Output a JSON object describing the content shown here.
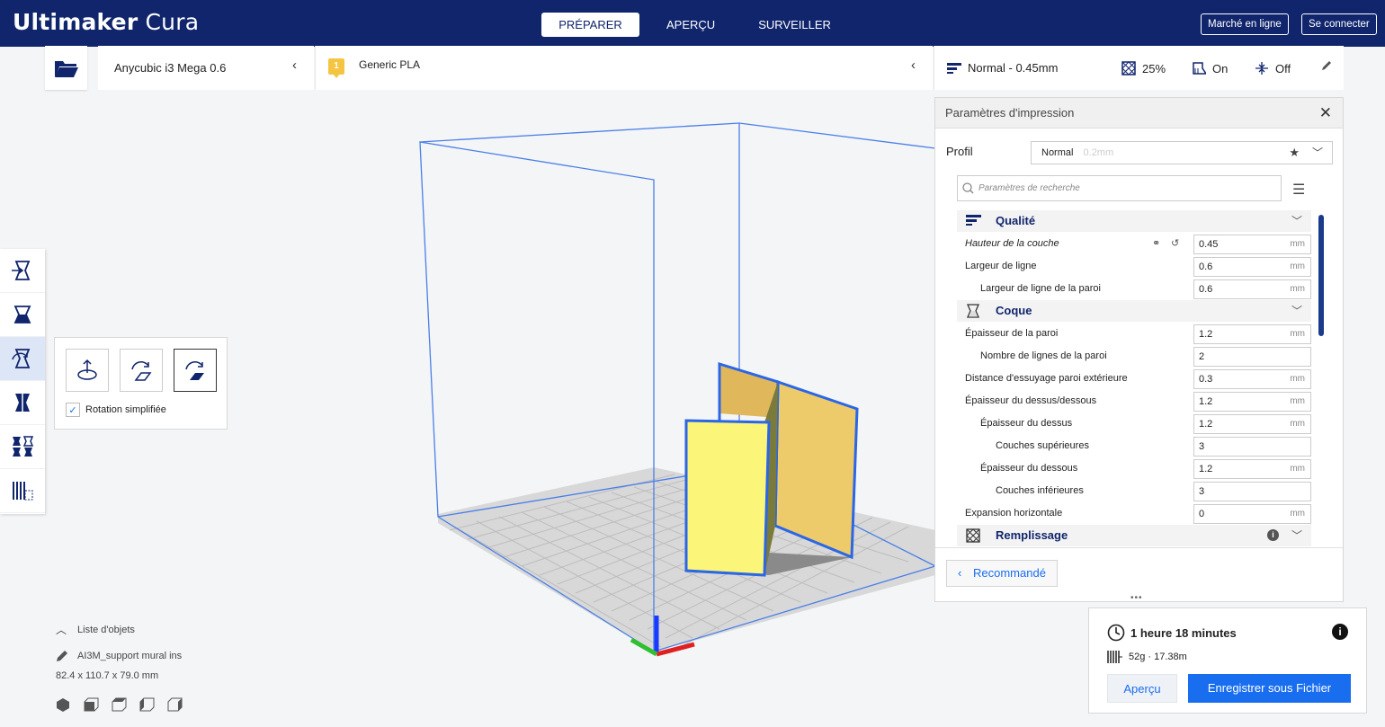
{
  "header": {
    "brand_bold": "Ultimaker",
    "brand_light": "Cura",
    "tabs": [
      {
        "label": "PRÉPARER"
      },
      {
        "label": "APERÇU"
      },
      {
        "label": "SURVEILLER"
      }
    ],
    "marketplace_label": "Marché en ligne",
    "login_label": "Se connecter"
  },
  "topbar": {
    "machine": "Anycubic i3 Mega 0.6",
    "material_badge": "1",
    "material": "Generic PLA",
    "profile_summary": "Normal - 0.45mm",
    "infill": "25%",
    "support": "On",
    "adhesion": "Off"
  },
  "rotate_panel": {
    "simplified_label": "Rotation simplifiée"
  },
  "object_list": {
    "toggle_label": "Liste d'objets",
    "object_name": "AI3M_support mural ins",
    "dimensions": "82.4 x 110.7 x 79.0 mm"
  },
  "print_settings": {
    "title": "Paramètres d'impression",
    "profile_label": "Profil",
    "profile_value": "Normal",
    "profile_hint": "0.2mm",
    "search_placeholder": "Paramètres de recherche",
    "categories": {
      "quality": "Qualité",
      "shell": "Coque",
      "infill": "Remplissage"
    },
    "rows": [
      {
        "label": "Hauteur de la couche",
        "value": "0.45",
        "unit": "mm"
      },
      {
        "label": "Largeur de ligne",
        "value": "0.6",
        "unit": "mm"
      },
      {
        "label": "Largeur de ligne de la paroi",
        "value": "0.6",
        "unit": "mm"
      },
      {
        "label": "Épaisseur de la paroi",
        "value": "1.2",
        "unit": "mm"
      },
      {
        "label": "Nombre de lignes de la paroi",
        "value": "2",
        "unit": ""
      },
      {
        "label": "Distance d'essuyage paroi extérieure",
        "value": "0.3",
        "unit": "mm"
      },
      {
        "label": "Épaisseur du dessus/dessous",
        "value": "1.2",
        "unit": "mm"
      },
      {
        "label": "Épaisseur du dessus",
        "value": "1.2",
        "unit": "mm"
      },
      {
        "label": "Couches supérieures",
        "value": "3",
        "unit": ""
      },
      {
        "label": "Épaisseur du dessous",
        "value": "1.2",
        "unit": "mm"
      },
      {
        "label": "Couches inférieures",
        "value": "3",
        "unit": ""
      },
      {
        "label": "Expansion horizontale",
        "value": "0",
        "unit": "mm"
      }
    ],
    "recommended_label": "Recommandé"
  },
  "action_panel": {
    "time": "1 heure 18 minutes",
    "material_usage": "52g · 17.38m",
    "preview_label": "Aperçu",
    "save_label": "Enregistrer sous Fichier"
  }
}
